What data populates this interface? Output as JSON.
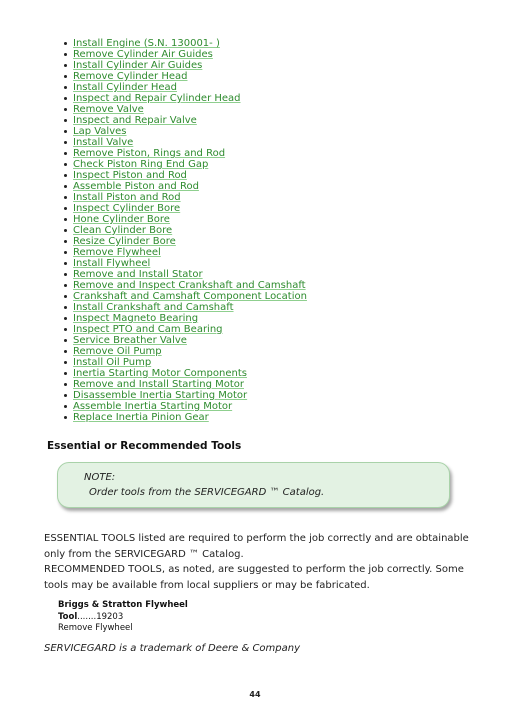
{
  "toc": {
    "items": [
      "Install Engine (S.N. 130001- )",
      "Remove Cylinder Air Guides",
      "Install Cylinder Air Guides",
      "Remove Cylinder Head",
      "Install Cylinder Head",
      "Inspect and Repair Cylinder Head",
      "Remove Valve",
      "Inspect and Repair Valve",
      "Lap Valves",
      "Install Valve",
      "Remove Piston, Rings and Rod",
      "Check Piston Ring End Gap",
      "Inspect Piston and Rod",
      "Assemble Piston and Rod",
      "Install Piston and Rod",
      "Inspect Cylinder Bore",
      "Hone Cylinder Bore",
      "Clean Cylinder Bore",
      "Resize Cylinder Bore",
      "Remove Flywheel",
      "Install Flywheel",
      "Remove and Install Stator",
      "Remove and Inspect Crankshaft and Camshaft",
      "Crankshaft and Camshaft Component Location",
      "Install Crankshaft and Camshaft",
      "Inspect Magneto Bearing",
      "Inspect PTO and Cam Bearing",
      "Service Breather Valve",
      "Remove Oil Pump",
      "Install Oil Pump",
      "Inertia Starting Motor Components",
      "Remove and Install Starting Motor",
      "Disassemble Inertia Starting Motor",
      "Assemble Inertia Starting Motor",
      "Replace Inertia Pinion Gear"
    ],
    "link_color": "#2e8b2e"
  },
  "section": {
    "heading": "Essential or Recommended Tools"
  },
  "note": {
    "label": "NOTE:",
    "text": "Order tools from the SERVICEGARD ™ Catalog."
  },
  "body": {
    "line1": "ESSENTIAL TOOLS listed are required to perform the job correctly and are obtainable only from the SERVICEGARD ™ Catalog.",
    "line2": "RECOMMENDED TOOLS, as noted, are suggested to perform the job correctly. Some tools may be available from local suppliers or may be fabricated."
  },
  "tool": {
    "name_line1": "Briggs & Stratton Flywheel",
    "name_line2": "Tool",
    "dots": ".......",
    "number": "19203",
    "use": "Remove Flywheel"
  },
  "trademark": "SERVICEGARD is a trademark of Deere & Company",
  "page_number": "44"
}
